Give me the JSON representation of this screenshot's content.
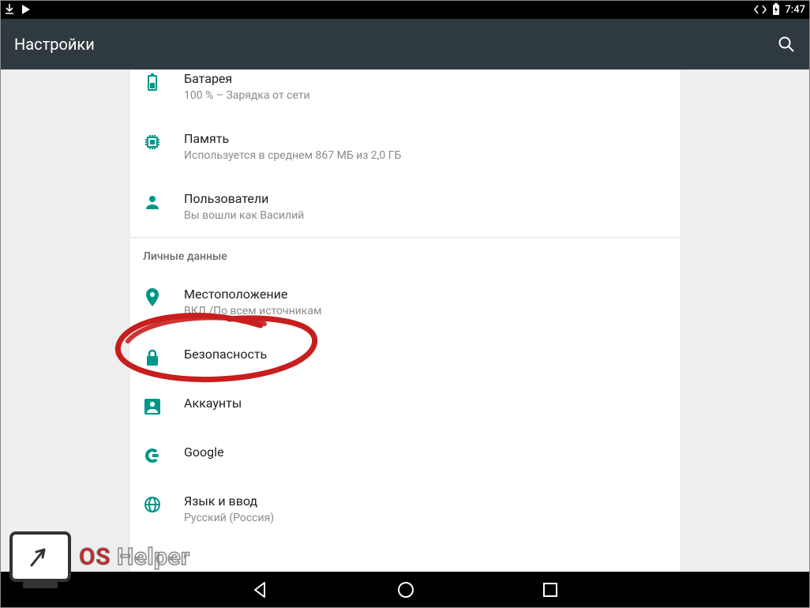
{
  "status": {
    "time": "7:47"
  },
  "appbar": {
    "title": "Настройки"
  },
  "items": {
    "battery": {
      "title": "Батарея",
      "sub": "100 % – Зарядка от сети"
    },
    "memory": {
      "title": "Память",
      "sub": "Используется в среднем 867 МБ из 2,0 ГБ"
    },
    "users": {
      "title": "Пользователи",
      "sub": "Вы вошли как Василий"
    },
    "location": {
      "title": "Местоположение",
      "sub": "ВКЛ./По всем источникам"
    },
    "security": {
      "title": "Безопасность"
    },
    "accounts": {
      "title": "Аккаунты"
    },
    "google": {
      "title": "Google"
    },
    "language": {
      "title": "Язык и ввод",
      "sub": "Русский (Россия)"
    }
  },
  "section": {
    "personal": "Личные данные"
  },
  "watermark": {
    "os": "OS",
    "helper": "Helper"
  },
  "colors": {
    "teal": "#009688",
    "red": "#c81e1e"
  }
}
